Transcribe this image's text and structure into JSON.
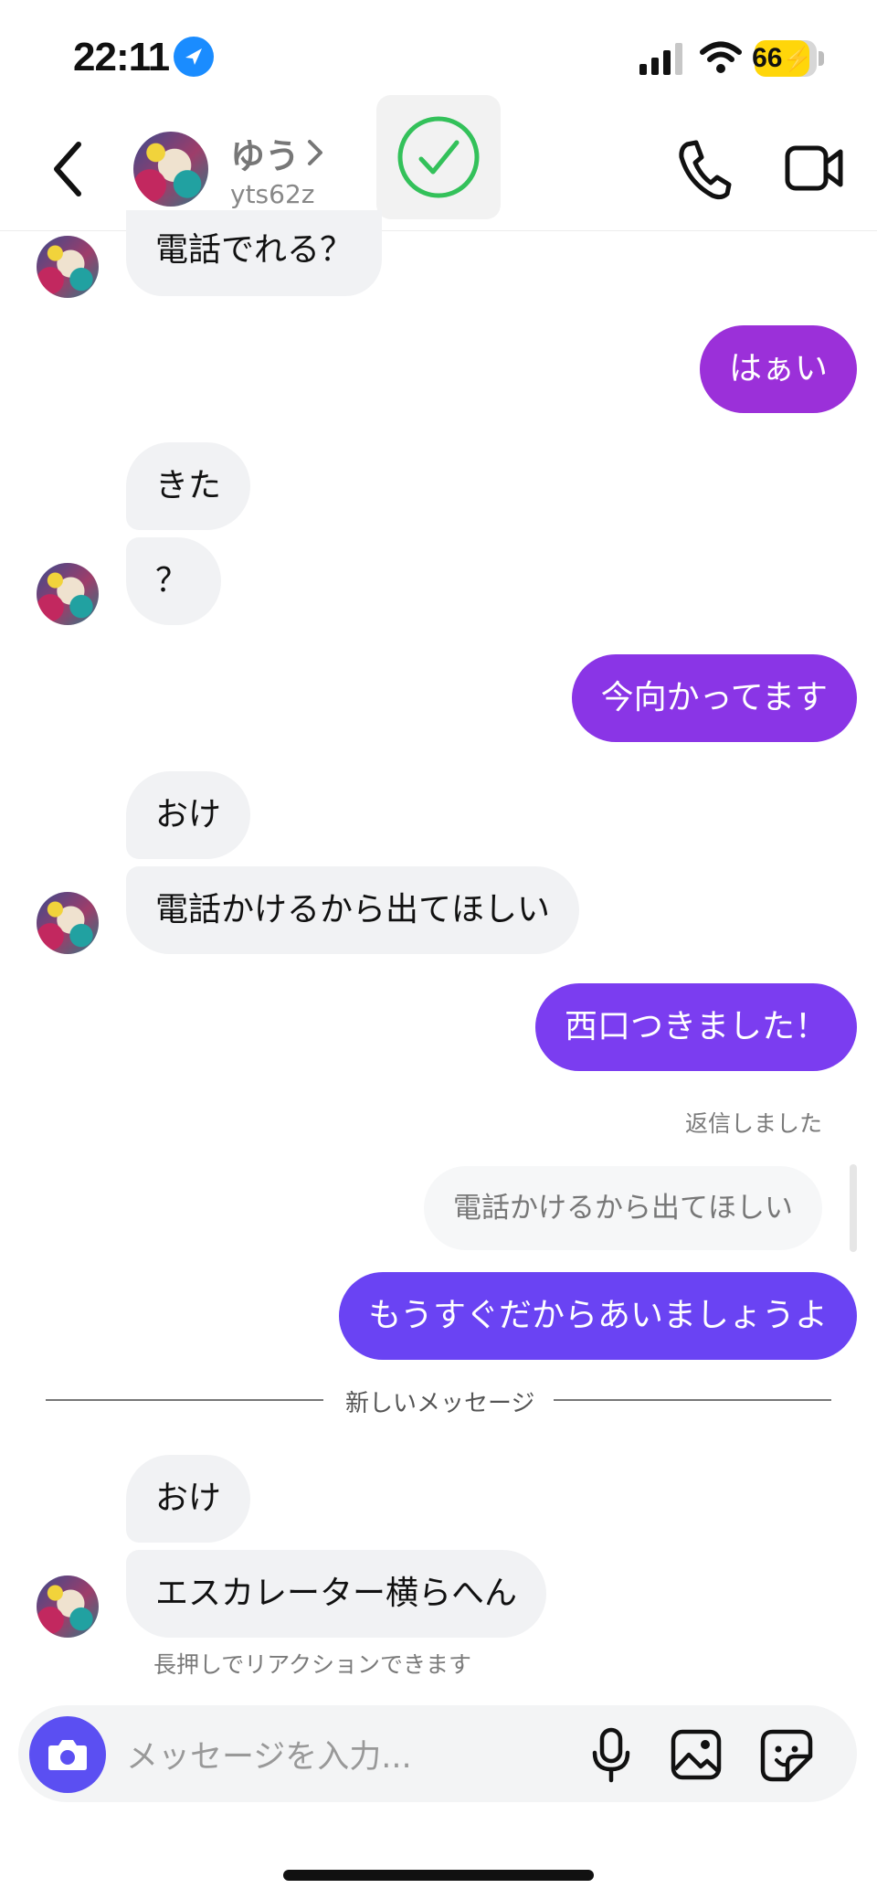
{
  "status_bar": {
    "time": "22:11",
    "battery": "66"
  },
  "header": {
    "name": "ゆう",
    "username": "yts62z",
    "accent_check_color": "#33c15a"
  },
  "colors": {
    "sent_purple_1": "#9b30d9",
    "sent_purple_2": "#8a35e6",
    "sent_purple_3": "#7b3df0",
    "sent_purple_4": "#6a43f3",
    "received_bg": "#f1f2f4"
  },
  "messages": {
    "m1": "電話でれる？",
    "m2": "はぁい",
    "m3": "きた",
    "m4": "？",
    "m5": "今向かってます",
    "m6": "おけ",
    "m7": "電話かけるから出てほしい",
    "m8": "西口つきました！",
    "reply_label": "返信しました",
    "reply_quote": "電話かけるから出てほしい",
    "m9": "もうすぐだからあいましょうよ",
    "new_messages_divider": "新しいメッセージ",
    "m10": "おけ",
    "m11": "エスカレーター横らへん",
    "reaction_hint": "長押しでリアクションできます"
  },
  "composer": {
    "placeholder": "メッセージを入力..."
  }
}
